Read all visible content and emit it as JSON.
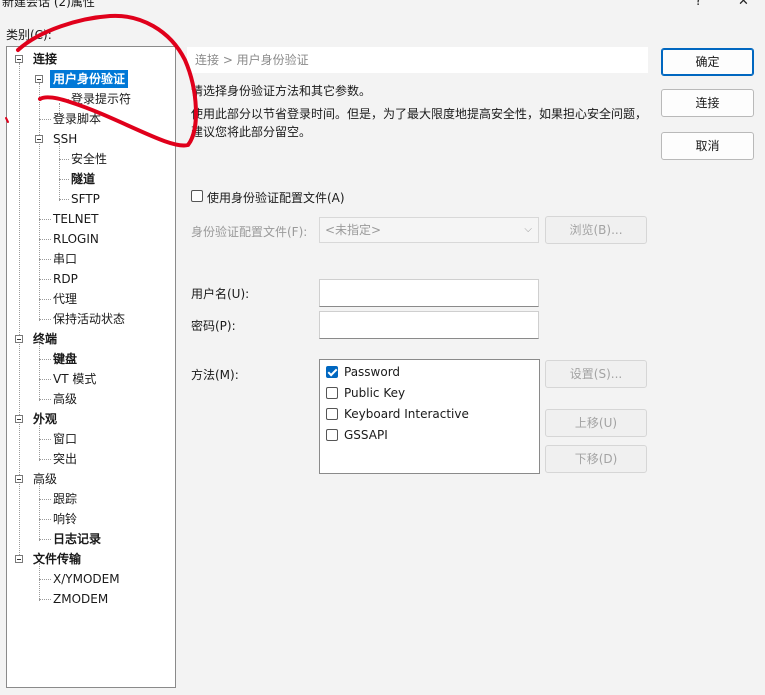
{
  "window": {
    "title": "新建会话 (2)属性",
    "help_glyph": "?",
    "close_glyph": "✕"
  },
  "category_label": "类别(C):",
  "tree": {
    "connection": "连接",
    "user_auth": "用户身份验证",
    "login_prompt": "登录提示符",
    "login_script": "登录脚本",
    "ssh": "SSH",
    "security": "安全性",
    "tunnel": "隧道",
    "sftp": "SFTP",
    "telnet": "TELNET",
    "rlogin": "RLOGIN",
    "serial": "串口",
    "rdp": "RDP",
    "proxy": "代理",
    "keepalive": "保持活动状态",
    "terminal": "终端",
    "keyboard": "键盘",
    "vt_mode": "VT 模式",
    "term_advanced": "高级",
    "appearance": "外观",
    "window": "窗口",
    "highlight": "突出",
    "advanced": "高级",
    "trace": "跟踪",
    "bell": "响铃",
    "logging": "日志记录",
    "file_transfer": "文件传输",
    "xymodem": "X/YMODEM",
    "zmodem": "ZMODEM"
  },
  "breadcrumb": "连接 > 用户身份验证",
  "description": {
    "line1": "请选择身份验证方法和其它参数。",
    "line2": "使用此部分以节省登录时间。但是，为了最大限度地提高安全性，如果担心安全问题，",
    "line3": "建议您将此部分留空。"
  },
  "auth_profile": {
    "checkbox_label": "使用身份验证配置文件(A)",
    "checked": false,
    "field_label": "身份验证配置文件(F):",
    "selected": "<未指定>",
    "browse_label": "浏览(B)..."
  },
  "username": {
    "label": "用户名(U):",
    "value": ""
  },
  "password": {
    "label": "密码(P):",
    "value": ""
  },
  "method": {
    "label": "方法(M):",
    "items": [
      {
        "label": "Password",
        "checked": true
      },
      {
        "label": "Public Key",
        "checked": false
      },
      {
        "label": "Keyboard Interactive",
        "checked": false
      },
      {
        "label": "GSSAPI",
        "checked": false
      }
    ],
    "setup_label": "设置(S)...",
    "move_up_label": "上移(U)",
    "move_down_label": "下移(D)"
  },
  "buttons": {
    "ok": "确定",
    "connect": "连接",
    "cancel": "取消"
  },
  "colors": {
    "selection": "#0078d7",
    "annotation": "#e0001b",
    "check_accent": "#0067c0"
  }
}
